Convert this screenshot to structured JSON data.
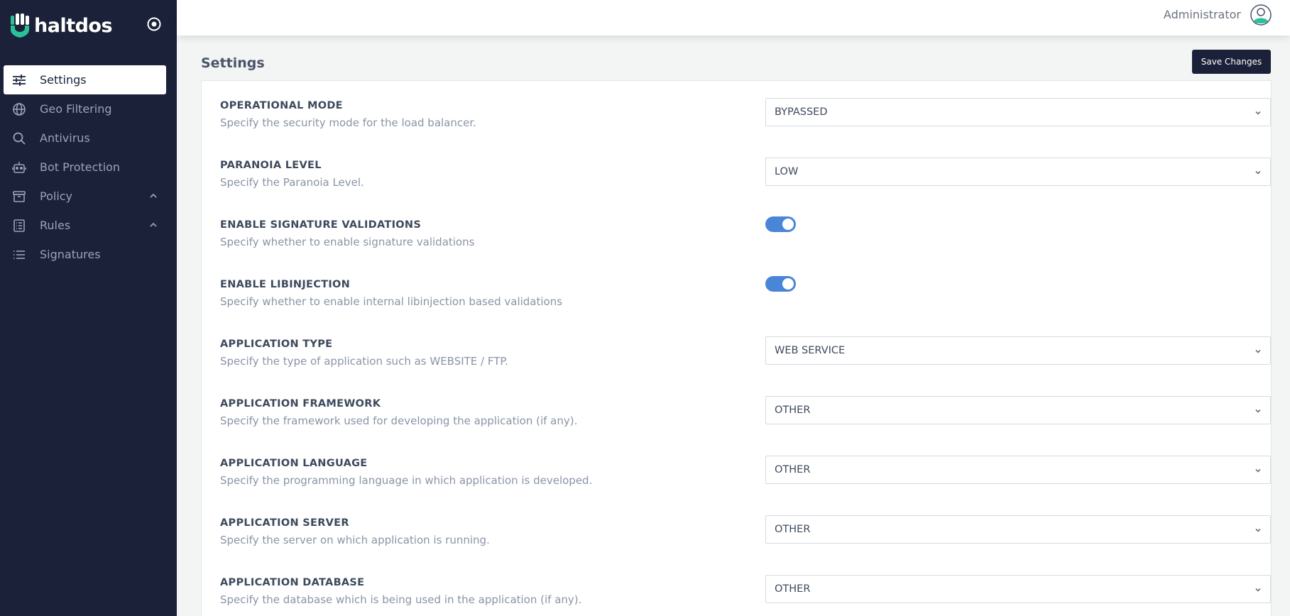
{
  "brand": {
    "name": "haltdos"
  },
  "sidebar": {
    "items": [
      {
        "label": "Settings",
        "icon": "sliders-icon",
        "active": true
      },
      {
        "label": "Geo Filtering",
        "icon": "globe-icon"
      },
      {
        "label": "Antivirus",
        "icon": "search-icon"
      },
      {
        "label": "Bot Protection",
        "icon": "robot-icon"
      },
      {
        "label": "Policy",
        "icon": "archive-icon",
        "expandable": true
      },
      {
        "label": "Rules",
        "icon": "list-box-icon",
        "expandable": true
      },
      {
        "label": "Signatures",
        "icon": "list-icon"
      }
    ]
  },
  "header": {
    "user": "Administrator"
  },
  "main": {
    "title": "Settings",
    "save_label": "Save Changes",
    "settings": [
      {
        "label": "OPERATIONAL MODE",
        "desc": "Specify the security mode for the load balancer.",
        "type": "select",
        "value": "BYPASSED"
      },
      {
        "label": "PARANOIA LEVEL",
        "desc": "Specify the Paranoia Level.",
        "type": "select",
        "value": "LOW"
      },
      {
        "label": "ENABLE SIGNATURE VALIDATIONS",
        "desc": "Specify whether to enable signature validations",
        "type": "toggle",
        "checked": true
      },
      {
        "label": "ENABLE LIBINJECTION",
        "desc": "Specify whether to enable internal libinjection based validations",
        "type": "toggle",
        "checked": true
      },
      {
        "label": "APPLICATION TYPE",
        "desc": "Specify the type of application such as WEBSITE / FTP.",
        "type": "select",
        "value": "WEB SERVICE"
      },
      {
        "label": "APPLICATION FRAMEWORK",
        "desc": "Specify the framework used for developing the application (if any).",
        "type": "select",
        "value": "OTHER"
      },
      {
        "label": "APPLICATION LANGUAGE",
        "desc": "Specify the programming language in which application is developed.",
        "type": "select",
        "value": "OTHER"
      },
      {
        "label": "APPLICATION SERVER",
        "desc": "Specify the server on which application is running.",
        "type": "select",
        "value": "OTHER"
      },
      {
        "label": "APPLICATION DATABASE",
        "desc": "Specify the database which is being used in the application (if any).",
        "type": "select",
        "value": "OTHER"
      }
    ]
  },
  "colors": {
    "sidebar_bg": "#1a2138",
    "accent": "#4a86d8",
    "brand_green": "#2bbf9a"
  }
}
